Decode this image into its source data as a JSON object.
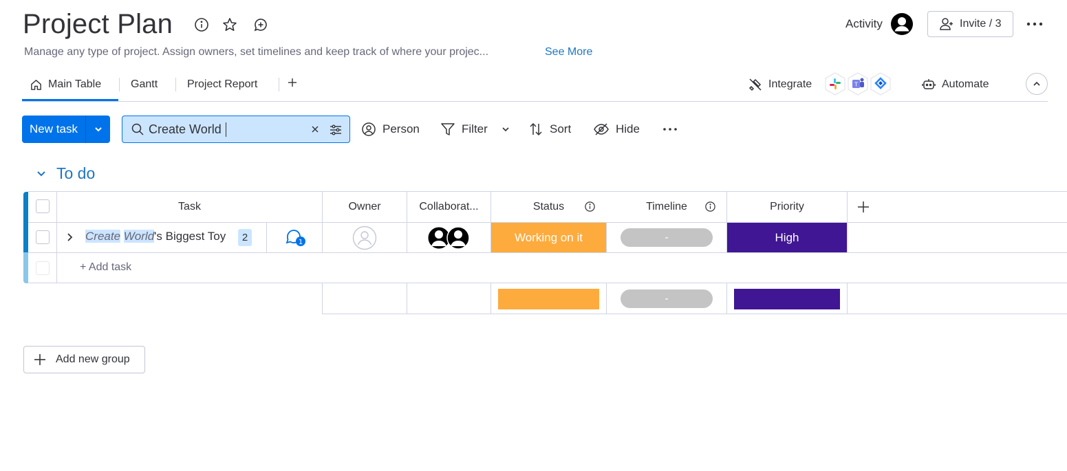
{
  "board": {
    "title": "Project Plan",
    "description": "Manage any type of project. Assign owners, set timelines and keep track of where your projec...",
    "see_more": "See More"
  },
  "header": {
    "activity_label": "Activity",
    "invite_label": "Invite / 3"
  },
  "tabs": [
    {
      "label": "Main Table",
      "active": true
    },
    {
      "label": "Gantt",
      "active": false
    },
    {
      "label": "Project Report",
      "active": false
    }
  ],
  "integrations": {
    "integrate_label": "Integrate",
    "apps": [
      "slack-icon",
      "teams-icon",
      "jira-icon"
    ],
    "automate_label": "Automate"
  },
  "toolbar": {
    "new_task_label": "New task",
    "search_value": "Create World",
    "person_label": "Person",
    "filter_label": "Filter",
    "sort_label": "Sort",
    "hide_label": "Hide"
  },
  "group": {
    "title": "To do",
    "color": "#0a80c8",
    "columns": {
      "task": "Task",
      "owner": "Owner",
      "collaborators": "Collaborat...",
      "status": "Status",
      "timeline": "Timeline",
      "priority": "Priority"
    },
    "rows": [
      {
        "task_hl1": "Create",
        "task_sp": " ",
        "task_hl2": "World",
        "task_rest": "'s Biggest Toy",
        "subitems": "2",
        "updates": "1",
        "status": "Working on it",
        "status_color": "#fdab3d",
        "timeline": "-",
        "priority": "High",
        "priority_color": "#401694"
      }
    ],
    "add_task": "+ Add task",
    "summary": {
      "timeline": "-"
    }
  },
  "add_group_label": "Add new group"
}
